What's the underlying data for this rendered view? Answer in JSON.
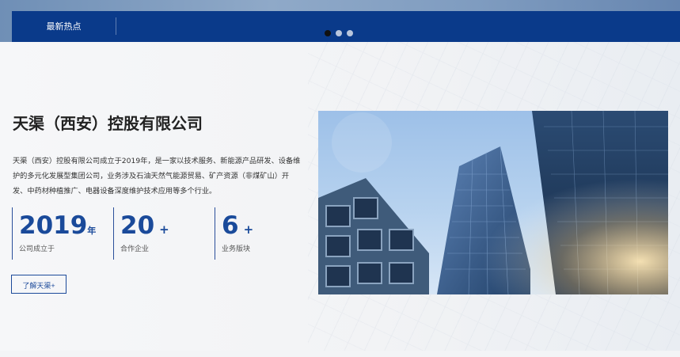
{
  "top": {
    "news_label": "最新热点",
    "ticker_text": "",
    "carousel": {
      "count": 3,
      "active": 0
    }
  },
  "company": {
    "title": "天渠（西安）控股有限公司",
    "description": "天渠（西安）控股有限公司成立于2019年，是一家以技术服务、新能源产品研发、设备维护的多元化发展型集团公司，业务涉及石油天然气能源贸易、矿产资源（非煤矿山）开发、中药材种植推广、电器设备深度维护技术应用等多个行业。",
    "stats": [
      {
        "value": "2019",
        "suffix": "年",
        "plus": "",
        "label": "公司成立于"
      },
      {
        "value": "20",
        "suffix": "",
        "plus": "+",
        "label": "合作企业"
      },
      {
        "value": "6",
        "suffix": "",
        "plus": "+",
        "label": "业务版块"
      }
    ],
    "learn_more": "了解天渠+"
  },
  "colors": {
    "brand_blue": "#0a3a8a",
    "stat_blue": "#1a4a9a"
  },
  "icons": {
    "photo": "glass-skyscrapers-photo"
  }
}
